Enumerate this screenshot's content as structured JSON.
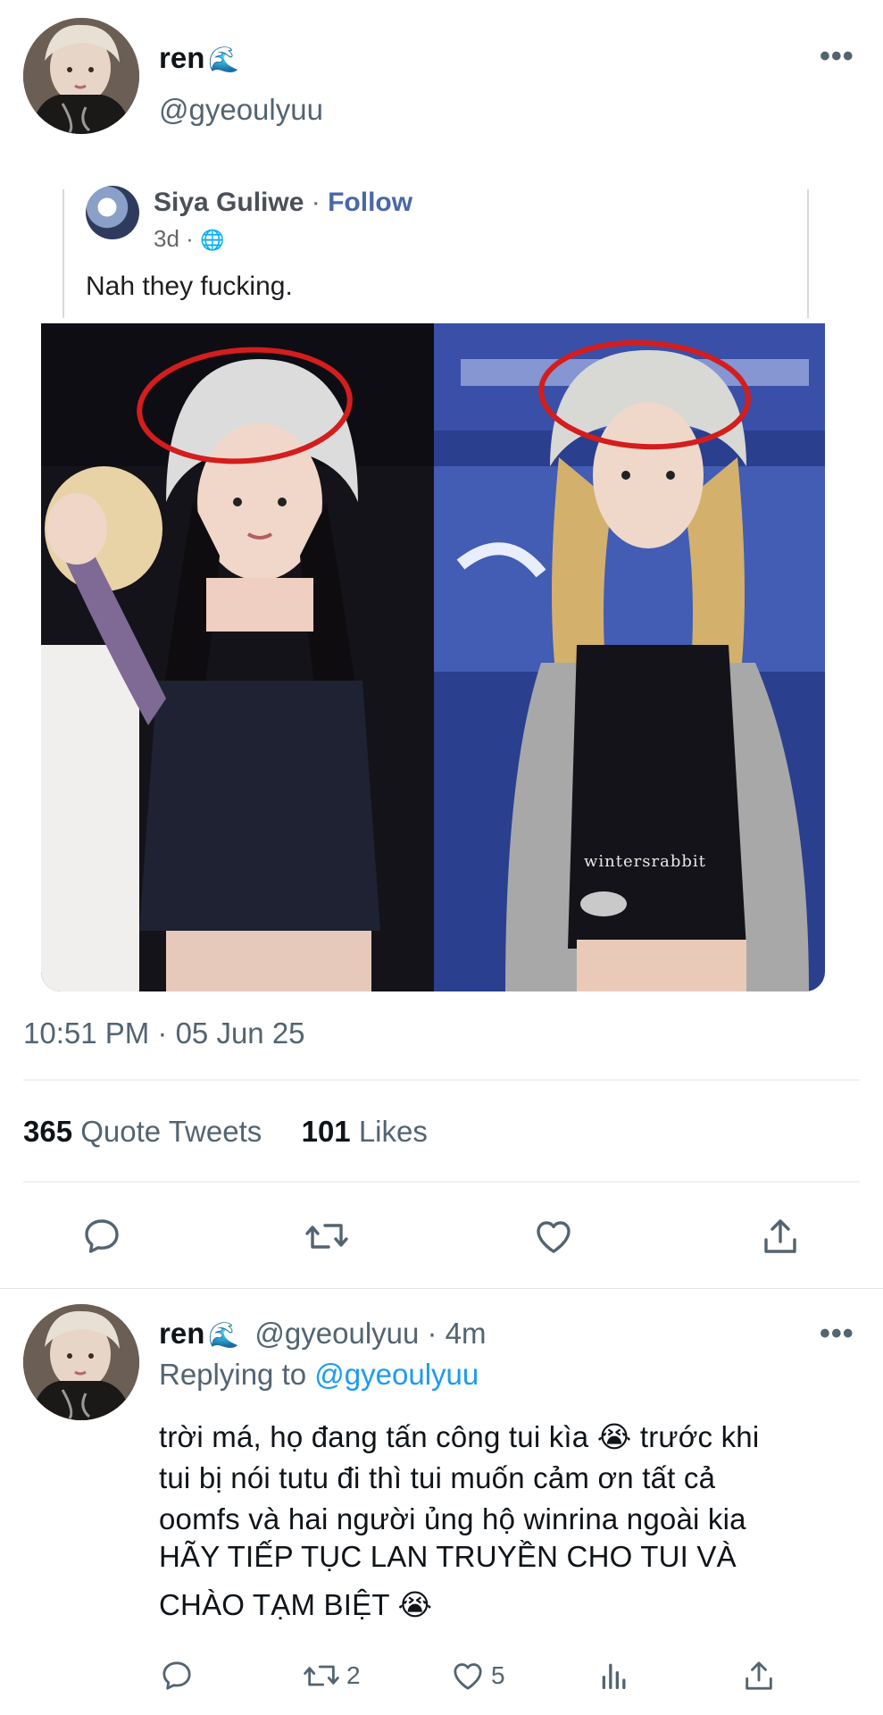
{
  "tweet": {
    "author_name": "ren",
    "author_emoji": "🌊",
    "author_handle": "@gyeoulyuu",
    "more_label": "•••",
    "embedded_post": {
      "name": "Siya Guliwe",
      "sep": "·",
      "follow": "Follow",
      "age": "3d ·",
      "globe": "🌐",
      "text": "Nah they fucking."
    },
    "image_watermark": "wintersrabbit",
    "timestamp": "10:51 PM · 05 Jun 25",
    "stats": {
      "quote_count": "365",
      "quote_label": "Quote Tweets",
      "like_count": "101",
      "like_label": "Likes"
    }
  },
  "reply": {
    "author_name": "ren",
    "author_emoji": "🌊",
    "meta": "@gyeoulyuu · 4m",
    "more_label": "•••",
    "replying_prefix": "Replying to",
    "replying_handle": "@gyeoulyuu",
    "lines": [
      "trời má, họ đang tấn công tui kìa 😭  trước khi",
      "tui bị nói tutu đi thì tui muốn cảm ơn tất cả",
      "oomfs và hai người ủng hộ winrina ngoài kia",
      "HÃY TIẾP TỤC LAN TRUYỀN CHO TUI VÀ",
      "CHÀO TẠM BIỆT 😭"
    ],
    "retweet_count": "2",
    "like_count": "5"
  },
  "icons": {
    "reply": "comment-icon",
    "retweet": "retweet-icon",
    "like": "heart-icon",
    "share": "share-icon",
    "analytics": "analytics-icon",
    "accent": "#1d9bf0",
    "muted": "#536471"
  }
}
